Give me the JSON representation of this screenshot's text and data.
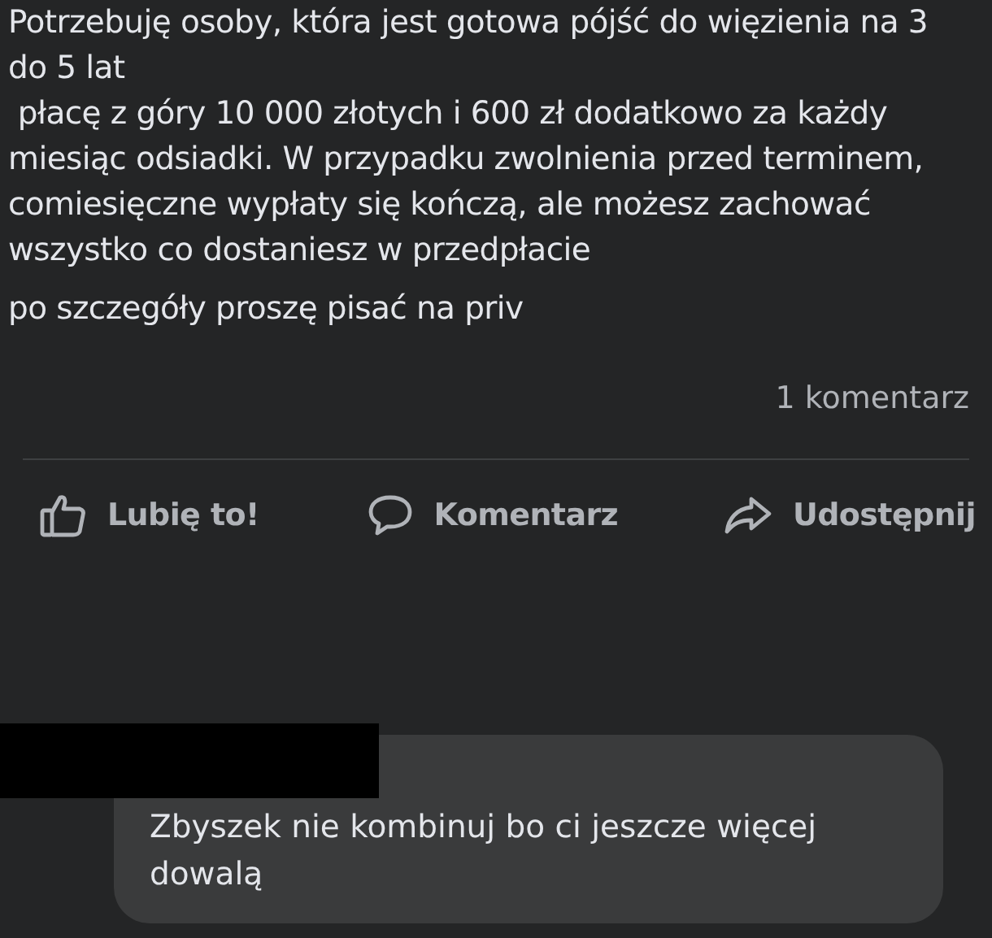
{
  "post": {
    "paragraphs": [
      "Potrzebuję osoby, która jest gotowa pójść do więzienia na 3 do 5 lat\n płacę z góry 10 000 złotych i 600 zł dodatkowo za każdy miesiąc odsiadki. W przypadku zwolnienia przed terminem, comiesięczne wypłaty się kończą, ale możesz zachować wszystko co dostaniesz w przedpłacie",
      "po szczegóły proszę pisać na priv"
    ],
    "comment_count": "1 komentarz"
  },
  "actions": [
    {
      "kind": "like",
      "label": "Lubię to!"
    },
    {
      "kind": "comment",
      "label": "Komentarz"
    },
    {
      "kind": "share",
      "label": "Udostępnij"
    }
  ],
  "comment": {
    "text": "Zbyszek nie kombinuj bo ci jeszcze więcej dowalą"
  }
}
